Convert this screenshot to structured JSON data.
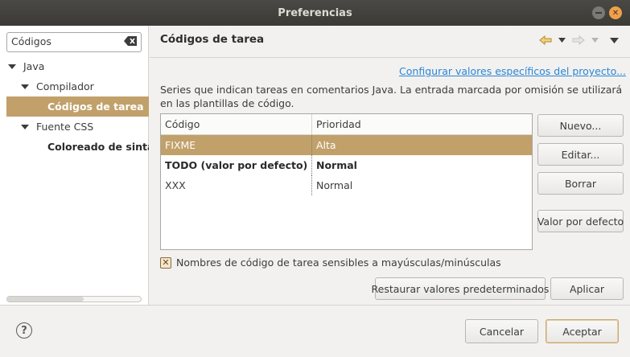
{
  "window": {
    "title": "Preferencias"
  },
  "sidebar": {
    "filter_value": "Códigos",
    "tree": [
      {
        "label": "Java",
        "expanded": true
      },
      {
        "label": "Compilador",
        "expanded": true
      },
      {
        "label": "Códigos de tarea",
        "selected": true
      },
      {
        "label": "Fuente CSS",
        "expanded": true
      },
      {
        "label": "Coloreado de sinta"
      }
    ]
  },
  "page": {
    "title": "Códigos de tarea",
    "configure_link": "Configurar valores específicos del proyecto...",
    "description": "Series que indican tareas en comentarios Java. La entrada marcada por omisión se utilizará en las plantillas de código.",
    "table": {
      "columns": [
        "Código",
        "Prioridad"
      ],
      "rows": [
        {
          "code": "FIXME",
          "priority": "Alta",
          "selected": true
        },
        {
          "code": "TODO (valor por defecto)",
          "priority": "Normal",
          "bold": true
        },
        {
          "code": "XXX",
          "priority": "Normal"
        }
      ]
    },
    "buttons": {
      "new": "Nuevo...",
      "edit": "Editar...",
      "remove": "Borrar",
      "default": "Valor por defecto"
    },
    "case_sensitive_label": "Nombres de código de tarea sensibles a mayúsculas/minúsculas",
    "case_sensitive_checked": true,
    "restore_defaults": "Restaurar valores predeterminados",
    "apply": "Aplicar"
  },
  "footer": {
    "help": "?",
    "cancel": "Cancelar",
    "ok": "Aceptar"
  },
  "colors": {
    "selection": "#c1a06a",
    "titlebar": "#3c3b37",
    "link": "#2a86d6"
  }
}
